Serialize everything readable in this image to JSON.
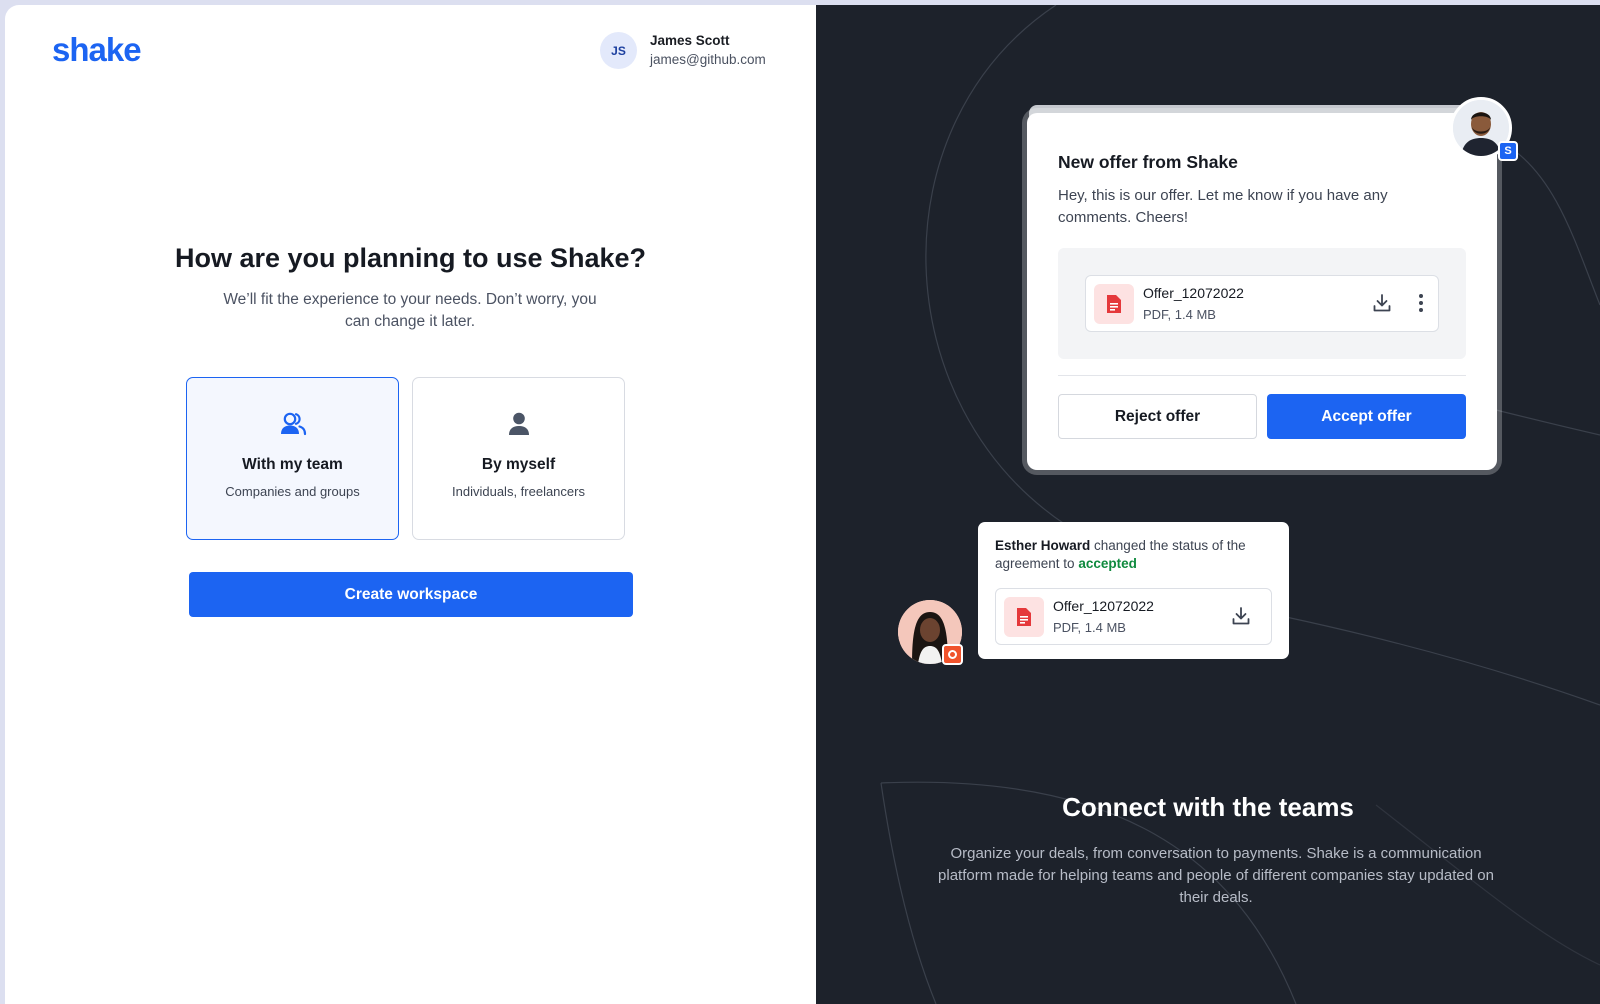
{
  "brand": {
    "logo": "shake",
    "accent": "#1c64f2"
  },
  "user": {
    "initials": "JS",
    "name": "James Scott",
    "email": "james@github.com"
  },
  "onboarding": {
    "heading": "How are you planning to use Shake?",
    "subtext": "We’ll fit the experience to your needs. Don’t worry, you can change it later.",
    "options": [
      {
        "title": "With my team",
        "subtitle": "Companies and groups",
        "icon": "users-icon",
        "selected": true
      },
      {
        "title": "By myself",
        "subtitle": "Individuals, freelancers",
        "icon": "user-icon",
        "selected": false
      }
    ],
    "cta": "Create workspace"
  },
  "showcase": {
    "offer_card": {
      "title": "New offer from Shake",
      "message": "Hey, this is our offer. Let me know if you have any comments. Cheers!",
      "file": {
        "name": "Offer_12072022",
        "meta": "PDF, 1.4 MB"
      },
      "reject_label": "Reject offer",
      "accept_label": "Accept offer",
      "badge": "S"
    },
    "notification": {
      "actor": "Esther Howard",
      "text": " changed the status of the agreement to ",
      "status": "accepted",
      "file": {
        "name": "Offer_12072022",
        "meta": "PDF, 1.4 MB"
      }
    },
    "title": "Connect with the teams",
    "description": "Organize your deals, from conversation to payments. Shake is a communication platform made for helping teams and people of different companies stay updated on their deals."
  }
}
